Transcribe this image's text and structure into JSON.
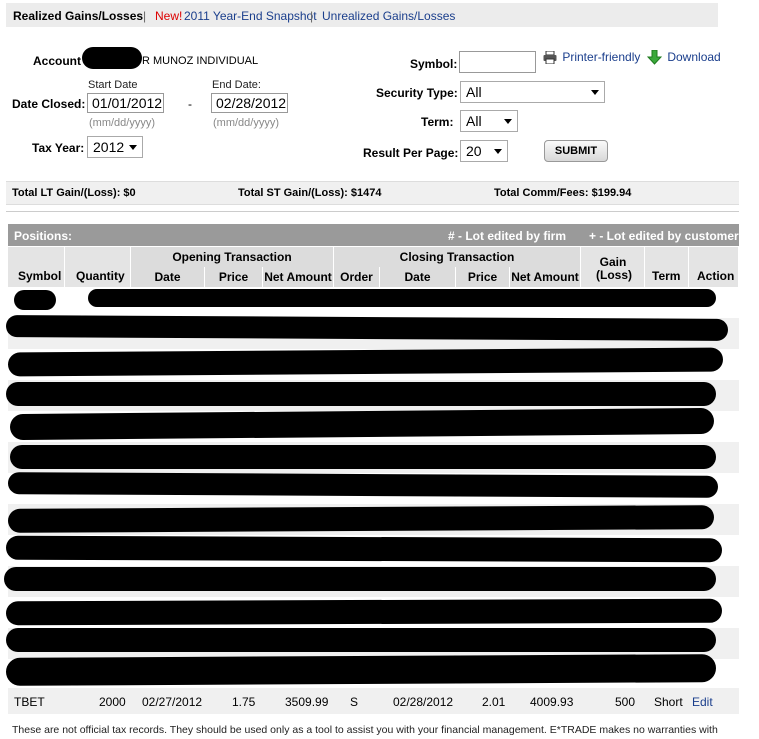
{
  "tabs": {
    "realized": "Realized Gains/Losses",
    "sep": "|",
    "new_badge": "New!",
    "snapshot": "2011 Year-End Snapshot",
    "unrealized": "Unrealized Gains/Losses"
  },
  "filters": {
    "account_label": "Account",
    "account_suffix": "R MUNOZ INDIVIDUAL",
    "start_date_label": "Start Date",
    "end_date_label": "End Date:",
    "date_closed_label": "Date Closed:",
    "start_date": "01/01/2012",
    "end_date": "02/28/2012",
    "dash": "-",
    "date_hint": "(mm/dd/yyyy)",
    "tax_year_label": "Tax Year:",
    "tax_year": "2012",
    "symbol_label": "Symbol:",
    "symbol_value": "",
    "security_type_label": "Security Type:",
    "security_type": "All",
    "term_label": "Term:",
    "term": "All",
    "result_per_page_label": "Result Per Page:",
    "result_per_page": "20",
    "submit": "SUBMIT",
    "printer_friendly": "Printer-friendly",
    "download": "Download"
  },
  "totals": {
    "lt": "Total LT Gain/(Loss): $0",
    "st": "Total ST Gain/(Loss): $1474",
    "fees": "Total Comm/Fees: $199.94"
  },
  "positions": {
    "title": "Positions:",
    "firm_note": "# - Lot edited by firm",
    "customer_note": "+ - Lot edited by customer",
    "group_opening": "Opening Transaction",
    "group_closing": "Closing Transaction",
    "columns": {
      "symbol": "Symbol",
      "quantity": "Quantity",
      "open_date": "Date",
      "open_price": "Price",
      "open_net": "Net Amount",
      "order": "Order",
      "close_date": "Date",
      "close_price": "Price",
      "close_net": "Net Amount",
      "gain": "Gain\n(Loss)",
      "term": "Term",
      "action": "Action"
    },
    "visible_row": {
      "symbol": "TBET",
      "quantity": "2000",
      "open_date": "02/27/2012",
      "open_price": "1.75",
      "open_net": "3509.99",
      "order": "S",
      "close_date": "02/28/2012",
      "close_price": "2.01",
      "close_net": "4009.93",
      "gain": "500",
      "term": "Short",
      "action": "Edit"
    }
  },
  "footer": "These are not official tax records. They should be used only as a tool to assist you with your financial management. E*TRADE makes no warranties with"
}
